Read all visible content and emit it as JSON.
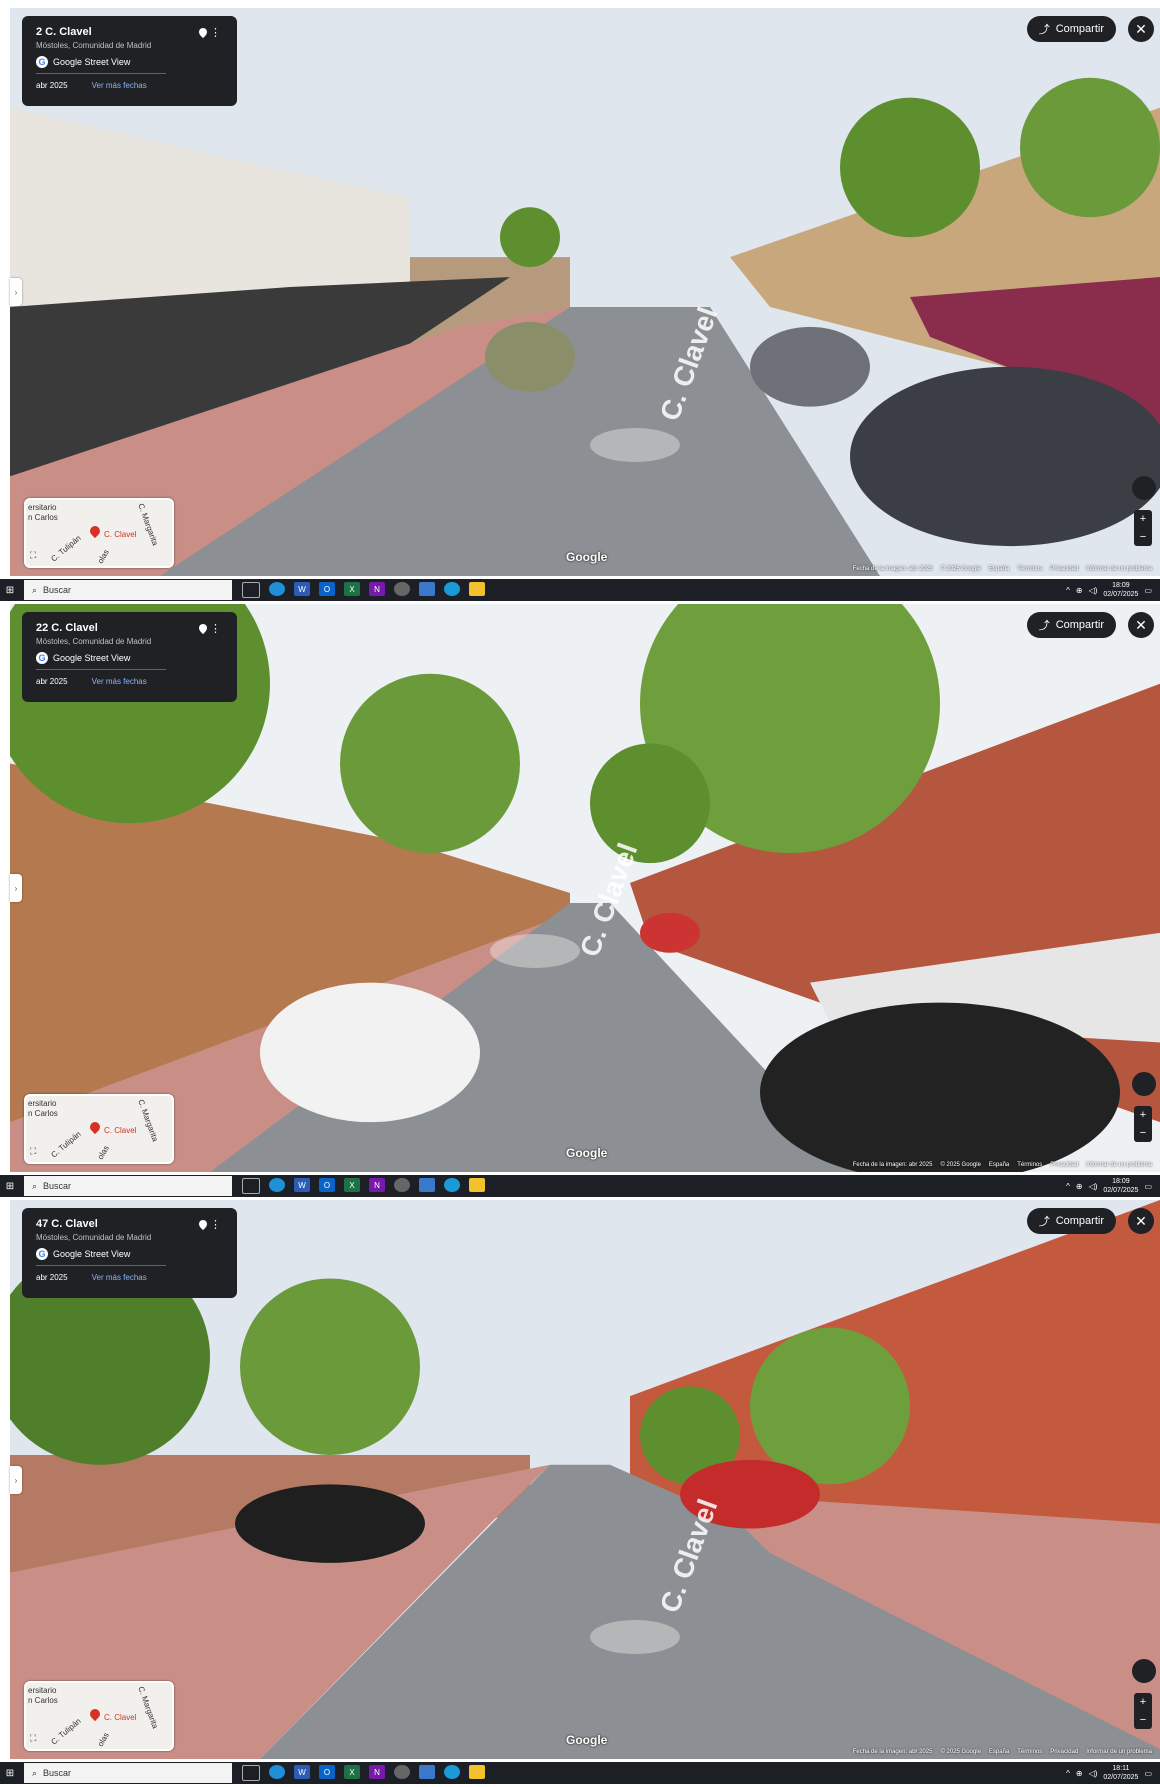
{
  "panels": [
    {
      "address": "2 C. Clavel",
      "locality": "Móstoles, Comunidad de Madrid",
      "service": "Google Street View",
      "date": "abr 2025",
      "more_dates": "Ver más fechas",
      "share": "Compartir",
      "street_label": "C. Clavel",
      "map_labels": [
        "ersitario",
        "n Carlos",
        "C. Clavel",
        "C. Tulipán",
        "C. Margarita",
        "olas"
      ],
      "watermark": "Google",
      "footer": [
        "Fecha de la imagen: abr 2025",
        "© 2025 Google",
        "España",
        "Términos",
        "Privacidad",
        "Informar de un problema"
      ],
      "taskbar": {
        "search": "Buscar",
        "time": "18:09",
        "date": "02/07/2025"
      }
    },
    {
      "address": "22 C. Clavel",
      "locality": "Móstoles, Comunidad de Madrid",
      "service": "Google Street View",
      "date": "abr 2025",
      "more_dates": "Ver más fechas",
      "share": "Compartir",
      "street_label": "C. Clavel",
      "map_labels": [
        "ersitario",
        "n Carlos",
        "C. Clavel",
        "C. Tulipán",
        "C. Margarita",
        "olas"
      ],
      "watermark": "Google",
      "footer": [
        "Fecha de la imagen: abr 2025",
        "© 2025 Google",
        "España",
        "Términos",
        "Privacidad",
        "Informar de un problema"
      ],
      "taskbar": {
        "search": "Buscar",
        "time": "18:09",
        "date": "02/07/2025"
      }
    },
    {
      "address": "47 C. Clavel",
      "locality": "Móstoles, Comunidad de Madrid",
      "service": "Google Street View",
      "date": "abr 2025",
      "more_dates": "Ver más fechas",
      "share": "Compartir",
      "street_label": "C. Clavel",
      "map_labels": [
        "ersitario",
        "n Carlos",
        "C. Clavel",
        "C. Tulipán",
        "C. Margarita",
        "olas"
      ],
      "watermark": "Google",
      "footer": [
        "Fecha de la imagen: abr 2025",
        "© 2025 Google",
        "España",
        "Términos",
        "Privacidad",
        "Informar de un problema"
      ],
      "taskbar": {
        "search": "Buscar",
        "time": "18:11",
        "date": "02/07/2025"
      }
    }
  ],
  "colors": {
    "sky": "#dfe6ee",
    "road": "#8c8f93",
    "sidewalk": "#c98f86",
    "brick": "#b5563f",
    "tree": "#5d8f2f",
    "card": "#202124",
    "link": "#8ab4f8",
    "taskbar": "#1c1f26"
  }
}
